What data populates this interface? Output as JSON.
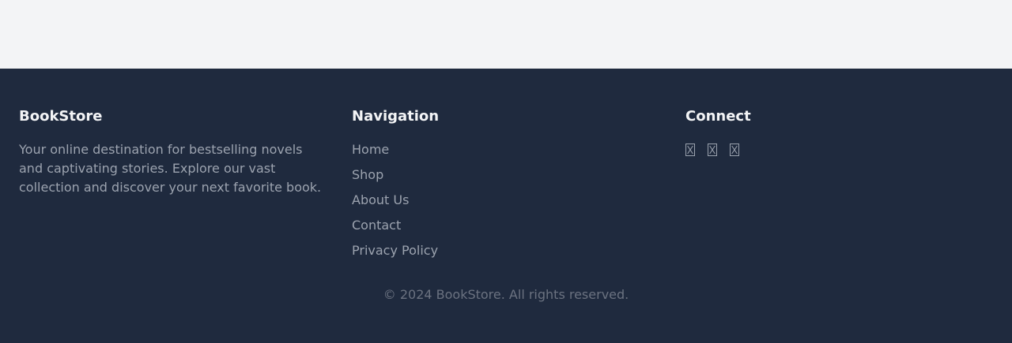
{
  "brand": {
    "title": "BookStore",
    "description": "Your online destination for bestselling novels and captivating stories. Explore our vast collection and discover your next favorite book."
  },
  "navigation": {
    "title": "Navigation",
    "links": [
      "Home",
      "Shop",
      "About Us",
      "Contact",
      "Privacy Policy"
    ]
  },
  "connect": {
    "title": "Connect",
    "icons": [
      "social-icon-1",
      "social-icon-2",
      "social-icon-3"
    ]
  },
  "copyright": "© 2024 BookStore. All rights reserved.",
  "colors": {
    "page_background": "#f3f4f6",
    "footer_background": "#1f2a3e",
    "heading": "#f3f4f6",
    "text": "#9ca3af",
    "muted": "#6b7280"
  }
}
